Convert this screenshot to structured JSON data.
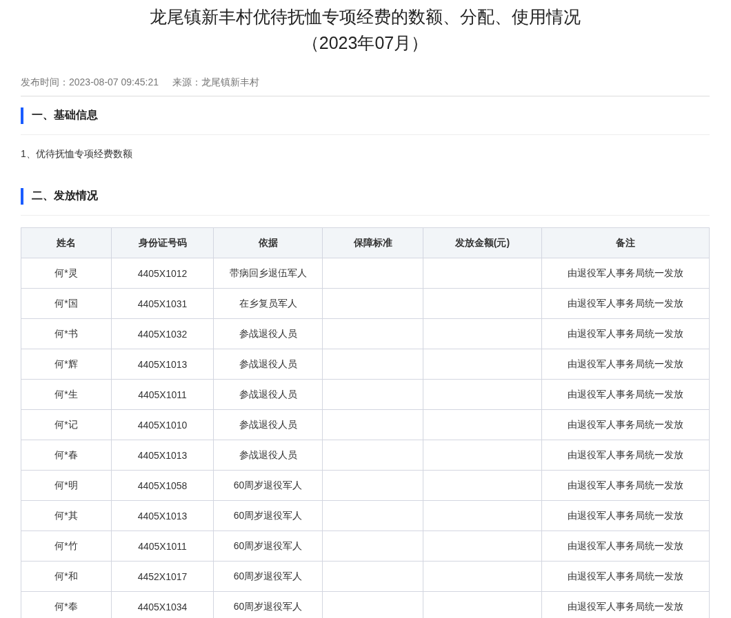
{
  "title": {
    "line_1": "龙尾镇新丰村优待抚恤专项经费的数额、分配、使用情况",
    "line_2": "（2023年07月）"
  },
  "meta": {
    "publish_time": "发布时间：2023-08-07 09:45:21",
    "source": "来源：龙尾镇新丰村"
  },
  "sections": [
    {
      "heading": "一、基础信息",
      "items": [
        "1、优待抚恤专项经费数额"
      ]
    },
    {
      "heading": "二、发放情况"
    }
  ],
  "table": {
    "columns": [
      "姓名",
      "身份证号码",
      "依据",
      "保障标准",
      "发放金额(元)",
      "备注"
    ],
    "rows": [
      {
        "name": "何*灵",
        "id": "4405X1012",
        "basis": "带病回乡退伍军人",
        "remark": "由退役军人事务局统一发放"
      },
      {
        "name": "何*国",
        "id": "4405X1031",
        "basis": "在乡复员军人",
        "remark": "由退役军人事务局统一发放"
      },
      {
        "name": "何*书",
        "id": "4405X1032",
        "basis": "参战退役人员",
        "remark": "由退役军人事务局统一发放"
      },
      {
        "name": "何*辉",
        "id": "4405X1013",
        "basis": "参战退役人员",
        "remark": "由退役军人事务局统一发放"
      },
      {
        "name": "何*生",
        "id": "4405X1011",
        "basis": "参战退役人员",
        "remark": "由退役军人事务局统一发放"
      },
      {
        "name": "何*记",
        "id": "4405X1010",
        "basis": "参战退役人员",
        "remark": "由退役军人事务局统一发放"
      },
      {
        "name": "何*春",
        "id": "4405X1013",
        "basis": "参战退役人员",
        "remark": "由退役军人事务局统一发放"
      },
      {
        "name": "何*明",
        "id": "4405X1058",
        "basis": "60周岁退役军人",
        "remark": "由退役军人事务局统一发放"
      },
      {
        "name": "何*其",
        "id": "4405X1013",
        "basis": "60周岁退役军人",
        "remark": "由退役军人事务局统一发放"
      },
      {
        "name": "何*竹",
        "id": "4405X1011",
        "basis": "60周岁退役军人",
        "remark": "由退役军人事务局统一发放"
      },
      {
        "name": "何*和",
        "id": "4452X1017",
        "basis": "60周岁退役军人",
        "remark": "由退役军人事务局统一发放"
      },
      {
        "name": "何*奉",
        "id": "4405X1034",
        "basis": "60周岁退役军人",
        "remark": "由退役军人事务局统一发放"
      }
    ]
  }
}
